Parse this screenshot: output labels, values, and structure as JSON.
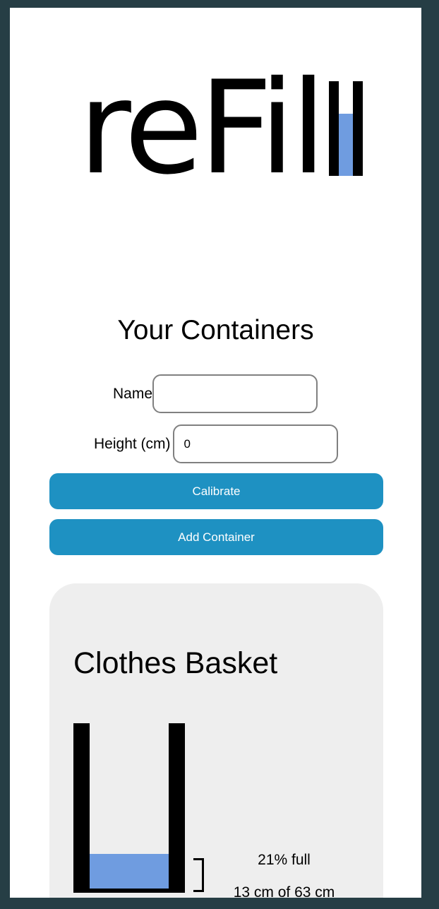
{
  "logo": {
    "text": "reFil",
    "glass_fill_fraction": 0.66,
    "fill_color": "#6f9ce0"
  },
  "containers_section": {
    "title": "Your Containers",
    "name_field": {
      "label": "Name",
      "value": ""
    },
    "height_field": {
      "label": "Height (cm)",
      "value": "0"
    },
    "calibrate_label": "Calibrate",
    "add_label": "Add Container",
    "button_color": "#1e91c2"
  },
  "containers": [
    {
      "name": "Clothes Basket",
      "fill_percent_text": "21% full",
      "measure_text": "13 cm of 63 cm",
      "fill_fraction": 0.21,
      "fill_color": "#6f9ce0"
    }
  ]
}
